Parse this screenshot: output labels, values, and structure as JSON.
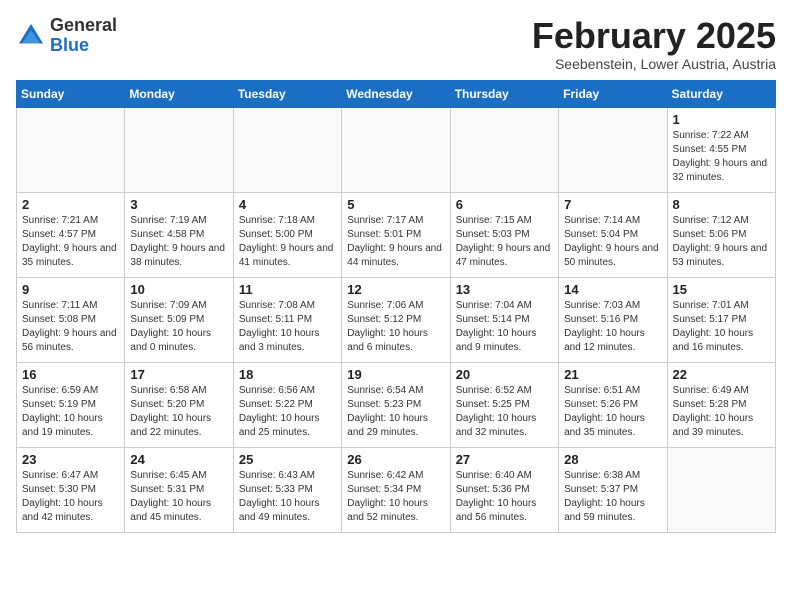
{
  "header": {
    "logo_general": "General",
    "logo_blue": "Blue",
    "month_title": "February 2025",
    "location": "Seebenstein, Lower Austria, Austria"
  },
  "days_of_week": [
    "Sunday",
    "Monday",
    "Tuesday",
    "Wednesday",
    "Thursday",
    "Friday",
    "Saturday"
  ],
  "weeks": [
    [
      {
        "day": "",
        "info": ""
      },
      {
        "day": "",
        "info": ""
      },
      {
        "day": "",
        "info": ""
      },
      {
        "day": "",
        "info": ""
      },
      {
        "day": "",
        "info": ""
      },
      {
        "day": "",
        "info": ""
      },
      {
        "day": "1",
        "info": "Sunrise: 7:22 AM\nSunset: 4:55 PM\nDaylight: 9 hours and 32 minutes."
      }
    ],
    [
      {
        "day": "2",
        "info": "Sunrise: 7:21 AM\nSunset: 4:57 PM\nDaylight: 9 hours and 35 minutes."
      },
      {
        "day": "3",
        "info": "Sunrise: 7:19 AM\nSunset: 4:58 PM\nDaylight: 9 hours and 38 minutes."
      },
      {
        "day": "4",
        "info": "Sunrise: 7:18 AM\nSunset: 5:00 PM\nDaylight: 9 hours and 41 minutes."
      },
      {
        "day": "5",
        "info": "Sunrise: 7:17 AM\nSunset: 5:01 PM\nDaylight: 9 hours and 44 minutes."
      },
      {
        "day": "6",
        "info": "Sunrise: 7:15 AM\nSunset: 5:03 PM\nDaylight: 9 hours and 47 minutes."
      },
      {
        "day": "7",
        "info": "Sunrise: 7:14 AM\nSunset: 5:04 PM\nDaylight: 9 hours and 50 minutes."
      },
      {
        "day": "8",
        "info": "Sunrise: 7:12 AM\nSunset: 5:06 PM\nDaylight: 9 hours and 53 minutes."
      }
    ],
    [
      {
        "day": "9",
        "info": "Sunrise: 7:11 AM\nSunset: 5:08 PM\nDaylight: 9 hours and 56 minutes."
      },
      {
        "day": "10",
        "info": "Sunrise: 7:09 AM\nSunset: 5:09 PM\nDaylight: 10 hours and 0 minutes."
      },
      {
        "day": "11",
        "info": "Sunrise: 7:08 AM\nSunset: 5:11 PM\nDaylight: 10 hours and 3 minutes."
      },
      {
        "day": "12",
        "info": "Sunrise: 7:06 AM\nSunset: 5:12 PM\nDaylight: 10 hours and 6 minutes."
      },
      {
        "day": "13",
        "info": "Sunrise: 7:04 AM\nSunset: 5:14 PM\nDaylight: 10 hours and 9 minutes."
      },
      {
        "day": "14",
        "info": "Sunrise: 7:03 AM\nSunset: 5:16 PM\nDaylight: 10 hours and 12 minutes."
      },
      {
        "day": "15",
        "info": "Sunrise: 7:01 AM\nSunset: 5:17 PM\nDaylight: 10 hours and 16 minutes."
      }
    ],
    [
      {
        "day": "16",
        "info": "Sunrise: 6:59 AM\nSunset: 5:19 PM\nDaylight: 10 hours and 19 minutes."
      },
      {
        "day": "17",
        "info": "Sunrise: 6:58 AM\nSunset: 5:20 PM\nDaylight: 10 hours and 22 minutes."
      },
      {
        "day": "18",
        "info": "Sunrise: 6:56 AM\nSunset: 5:22 PM\nDaylight: 10 hours and 25 minutes."
      },
      {
        "day": "19",
        "info": "Sunrise: 6:54 AM\nSunset: 5:23 PM\nDaylight: 10 hours and 29 minutes."
      },
      {
        "day": "20",
        "info": "Sunrise: 6:52 AM\nSunset: 5:25 PM\nDaylight: 10 hours and 32 minutes."
      },
      {
        "day": "21",
        "info": "Sunrise: 6:51 AM\nSunset: 5:26 PM\nDaylight: 10 hours and 35 minutes."
      },
      {
        "day": "22",
        "info": "Sunrise: 6:49 AM\nSunset: 5:28 PM\nDaylight: 10 hours and 39 minutes."
      }
    ],
    [
      {
        "day": "23",
        "info": "Sunrise: 6:47 AM\nSunset: 5:30 PM\nDaylight: 10 hours and 42 minutes."
      },
      {
        "day": "24",
        "info": "Sunrise: 6:45 AM\nSunset: 5:31 PM\nDaylight: 10 hours and 45 minutes."
      },
      {
        "day": "25",
        "info": "Sunrise: 6:43 AM\nSunset: 5:33 PM\nDaylight: 10 hours and 49 minutes."
      },
      {
        "day": "26",
        "info": "Sunrise: 6:42 AM\nSunset: 5:34 PM\nDaylight: 10 hours and 52 minutes."
      },
      {
        "day": "27",
        "info": "Sunrise: 6:40 AM\nSunset: 5:36 PM\nDaylight: 10 hours and 56 minutes."
      },
      {
        "day": "28",
        "info": "Sunrise: 6:38 AM\nSunset: 5:37 PM\nDaylight: 10 hours and 59 minutes."
      },
      {
        "day": "",
        "info": ""
      }
    ]
  ]
}
